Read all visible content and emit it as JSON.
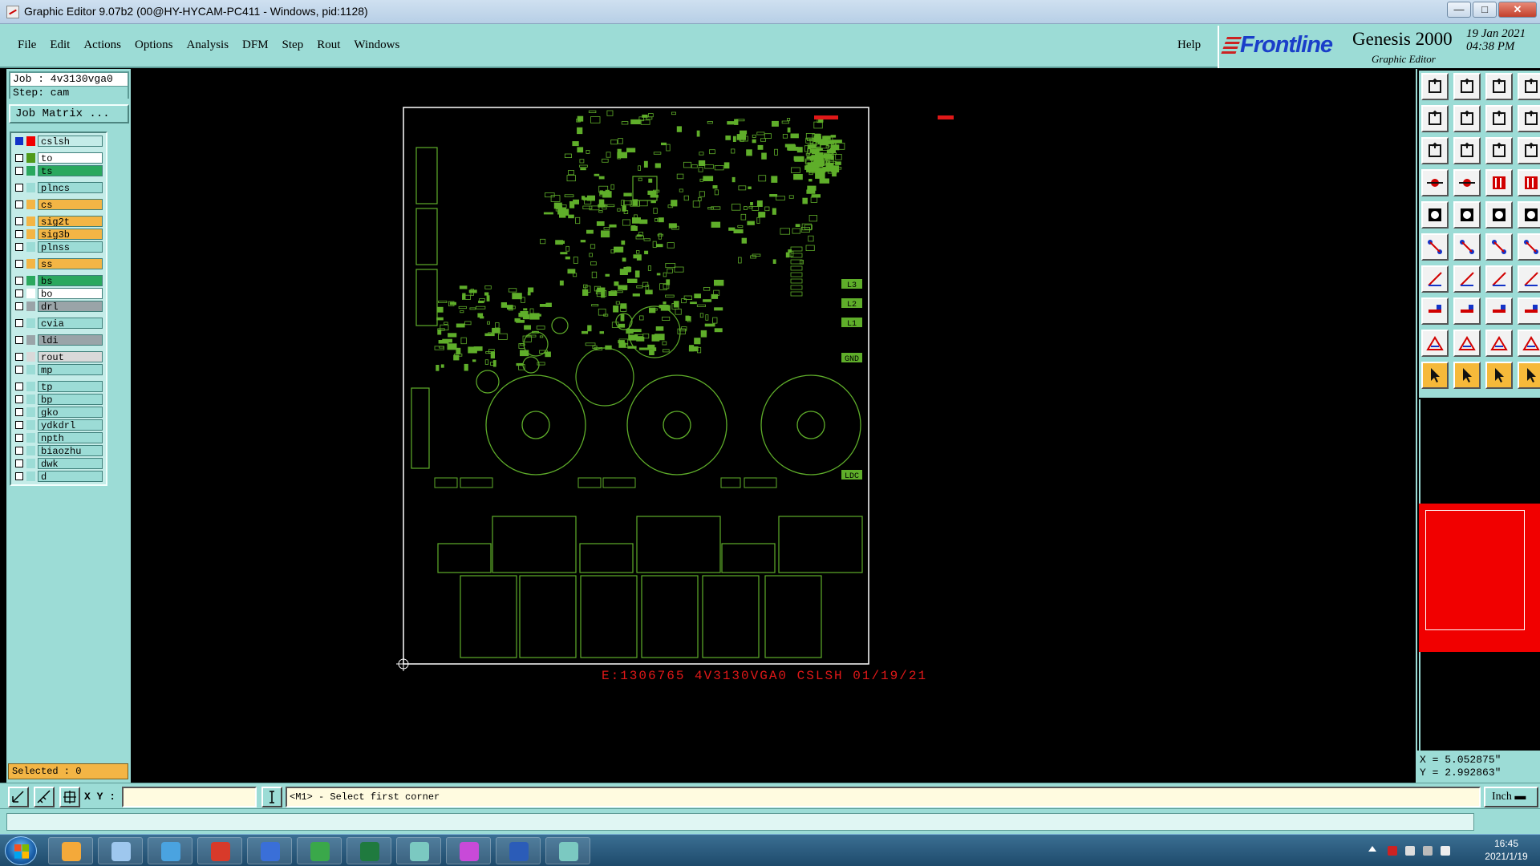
{
  "window": {
    "title": "Graphic Editor 9.07b2 (00@HY-HYCAM-PC411 - Windows, pid:1128)",
    "buttons": {
      "minimize": "—",
      "maximize": "□",
      "close": "✕"
    }
  },
  "menu": {
    "items": [
      "File",
      "Edit",
      "Actions",
      "Options",
      "Analysis",
      "DFM",
      "Step",
      "Rout",
      "Windows"
    ],
    "help": "Help"
  },
  "brand": {
    "logo": "Frontline",
    "product": "Genesis 2000",
    "subtitle": "Graphic Editor",
    "date": "19 Jan 2021\n04:38 PM"
  },
  "job": {
    "job_line": "Job : 4v3130vga0",
    "step_line": "Step: cam",
    "matrix_button": "Job Matrix ..."
  },
  "layers": [
    {
      "name": "cslsh",
      "color": "#f10000",
      "bg": "#c4ece8",
      "checked": true,
      "work": true
    },
    {
      "name": "to",
      "color": "#4f9a1a",
      "bg": "#ffffff",
      "checked": false
    },
    {
      "name": "ts",
      "color": "#2aa85e",
      "bg": "#2aa85e",
      "checked": false
    },
    {
      "name": "plncs",
      "color": "#9cdcd6",
      "bg": "#9cdcd6",
      "checked": false
    },
    {
      "name": "cs",
      "color": "#f3b545",
      "bg": "#f3b545",
      "checked": false
    },
    {
      "name": "sig2t",
      "color": "#f3b545",
      "bg": "#f3b545",
      "checked": false
    },
    {
      "name": "sig3b",
      "color": "#f3b545",
      "bg": "#f3b545",
      "checked": false
    },
    {
      "name": "plnss",
      "color": "#9cdcd6",
      "bg": "#9cdcd6",
      "checked": false
    },
    {
      "name": "ss",
      "color": "#f3b545",
      "bg": "#f3b545",
      "checked": false
    },
    {
      "name": "bs",
      "color": "#2aa85e",
      "bg": "#2aa85e",
      "checked": false
    },
    {
      "name": "bo",
      "color": "#ffffff",
      "bg": "#ffffff",
      "checked": false
    },
    {
      "name": "drl",
      "color": "#9aa4a8",
      "bg": "#9aa4a8",
      "checked": false
    },
    {
      "name": "cvia",
      "color": "#9cdcd6",
      "bg": "#9cdcd6",
      "checked": false
    },
    {
      "name": "ldi",
      "color": "#9aa4a8",
      "bg": "#9aa4a8",
      "checked": false
    },
    {
      "name": "rout",
      "color": "#d9d9d9",
      "bg": "#d9d9d9",
      "checked": false
    },
    {
      "name": "mp",
      "color": "#9cdcd6",
      "bg": "#9cdcd6",
      "checked": false
    },
    {
      "name": "tp",
      "color": "#9cdcd6",
      "bg": "#9cdcd6",
      "checked": false
    },
    {
      "name": "bp",
      "color": "#9cdcd6",
      "bg": "#9cdcd6",
      "checked": false
    },
    {
      "name": "gko",
      "color": "#9cdcd6",
      "bg": "#9cdcd6",
      "checked": false
    },
    {
      "name": "ydkdrl",
      "color": "#9cdcd6",
      "bg": "#9cdcd6",
      "checked": false
    },
    {
      "name": "npth",
      "color": "#9cdcd6",
      "bg": "#9cdcd6",
      "checked": false
    },
    {
      "name": "biaozhu",
      "color": "#9cdcd6",
      "bg": "#9cdcd6",
      "checked": false
    },
    {
      "name": "dwk",
      "color": "#9cdcd6",
      "bg": "#9cdcd6",
      "checked": false
    },
    {
      "name": "d",
      "color": "#9cdcd6",
      "bg": "#9cdcd6",
      "checked": false
    }
  ],
  "selected_label": "Selected : 0",
  "canvas": {
    "board_text": "E:1306765 4V3130VGA0 CSLSH 01/19/21",
    "silk_labels": [
      "L3",
      "L2",
      "L1",
      "GND",
      "LDC"
    ],
    "colors": {
      "board": "#5fae2a",
      "outline": "#ffffff",
      "red_text": "#e01818",
      "background": "#000000"
    }
  },
  "coords": {
    "text": "X = 5.052875\"\nY = 2.992863\""
  },
  "command": {
    "xy_label": "X Y :",
    "xy_value": "",
    "prompt": "<M1> - Select first corner",
    "units": "Inch"
  },
  "taskbar": {
    "time": "16:45\n2021/1/19"
  }
}
